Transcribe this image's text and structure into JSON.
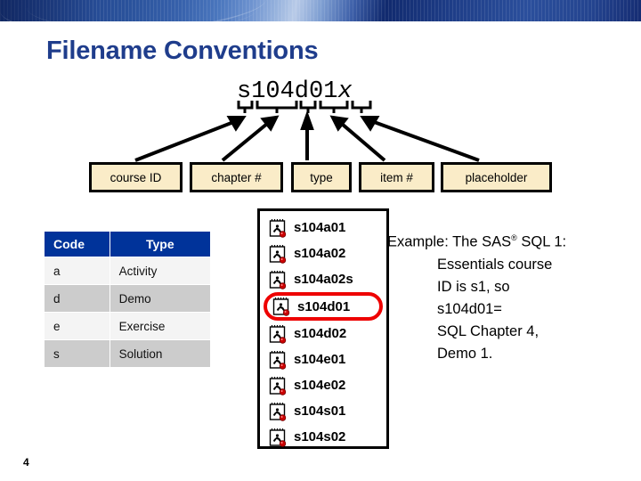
{
  "slide": {
    "title": "Filename Conventions",
    "page_number": "4",
    "banner_color": "#1f3d8c",
    "title_color": "#1f3d8c"
  },
  "filename": {
    "prefix": "s104d01",
    "suffix_italic": "x",
    "full": "s104d01x"
  },
  "parts": [
    {
      "label": "course ID",
      "segment": "s"
    },
    {
      "label": "chapter #",
      "segment": "104"
    },
    {
      "label": "type",
      "segment": "d"
    },
    {
      "label": "item #",
      "segment": "01"
    },
    {
      "label": "placeholder",
      "segment": "x"
    }
  ],
  "code_table": {
    "headers": [
      "Code",
      "Type"
    ],
    "header_bg": "#00339a",
    "rows": [
      {
        "code": "a",
        "type": "Activity"
      },
      {
        "code": "d",
        "type": "Demo"
      },
      {
        "code": "e",
        "type": "Exercise"
      },
      {
        "code": "s",
        "type": "Solution"
      }
    ]
  },
  "file_list": {
    "highlight_color": "#ee0000",
    "files": [
      {
        "name": "s104a01",
        "selected": false,
        "icon": "sas-program-icon"
      },
      {
        "name": "s104a02",
        "selected": false,
        "icon": "sas-program-icon"
      },
      {
        "name": "s104a02s",
        "selected": false,
        "icon": "sas-program-icon"
      },
      {
        "name": "s104d01",
        "selected": true,
        "icon": "sas-program-icon"
      },
      {
        "name": "s104d02",
        "selected": false,
        "icon": "sas-program-icon"
      },
      {
        "name": "s104e01",
        "selected": false,
        "icon": "sas-program-icon"
      },
      {
        "name": "s104e02",
        "selected": false,
        "icon": "sas-program-icon"
      },
      {
        "name": "s104s01",
        "selected": false,
        "icon": "sas-program-icon"
      },
      {
        "name": "s104s02",
        "selected": false,
        "icon": "sas-program-icon"
      }
    ]
  },
  "example": {
    "line1_a": "Example: ",
    "line1_b": "The SAS",
    "line1_sup": "®",
    "line1_c": " SQL 1:",
    "line2": "Essentials course",
    "line3": "ID is s1, so",
    "line4": "s104d01=",
    "line5": "SQL Chapter 4,",
    "line6": "Demo 1."
  }
}
